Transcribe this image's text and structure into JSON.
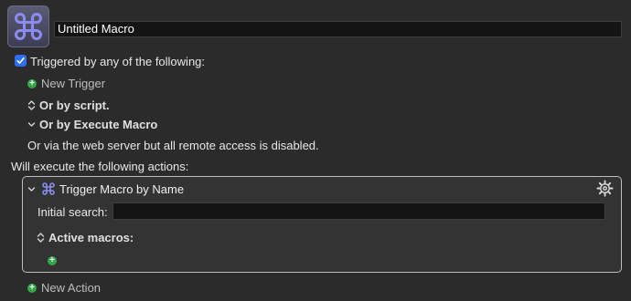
{
  "macro": {
    "icon": "command-key-icon",
    "title": "Untitled Macro"
  },
  "triggers": {
    "checked": true,
    "header": "Triggered by any of the following:",
    "new_trigger": "New Trigger",
    "or_by_script": "Or by script.",
    "or_by_execute_macro": "Or by Execute Macro",
    "web_server_note": "Or via the web server but all remote access is disabled."
  },
  "actions": {
    "header": "Will execute the following actions:",
    "action_title": "Trigger Macro by Name",
    "initial_search_label": "Initial search:",
    "initial_search_value": "",
    "active_macros_label": "Active macros:",
    "new_action": "New Action"
  },
  "colors": {
    "accent_blue": "#2f6ff0",
    "add_green": "#32a84a",
    "icon_purple": "#8c8cf0"
  }
}
